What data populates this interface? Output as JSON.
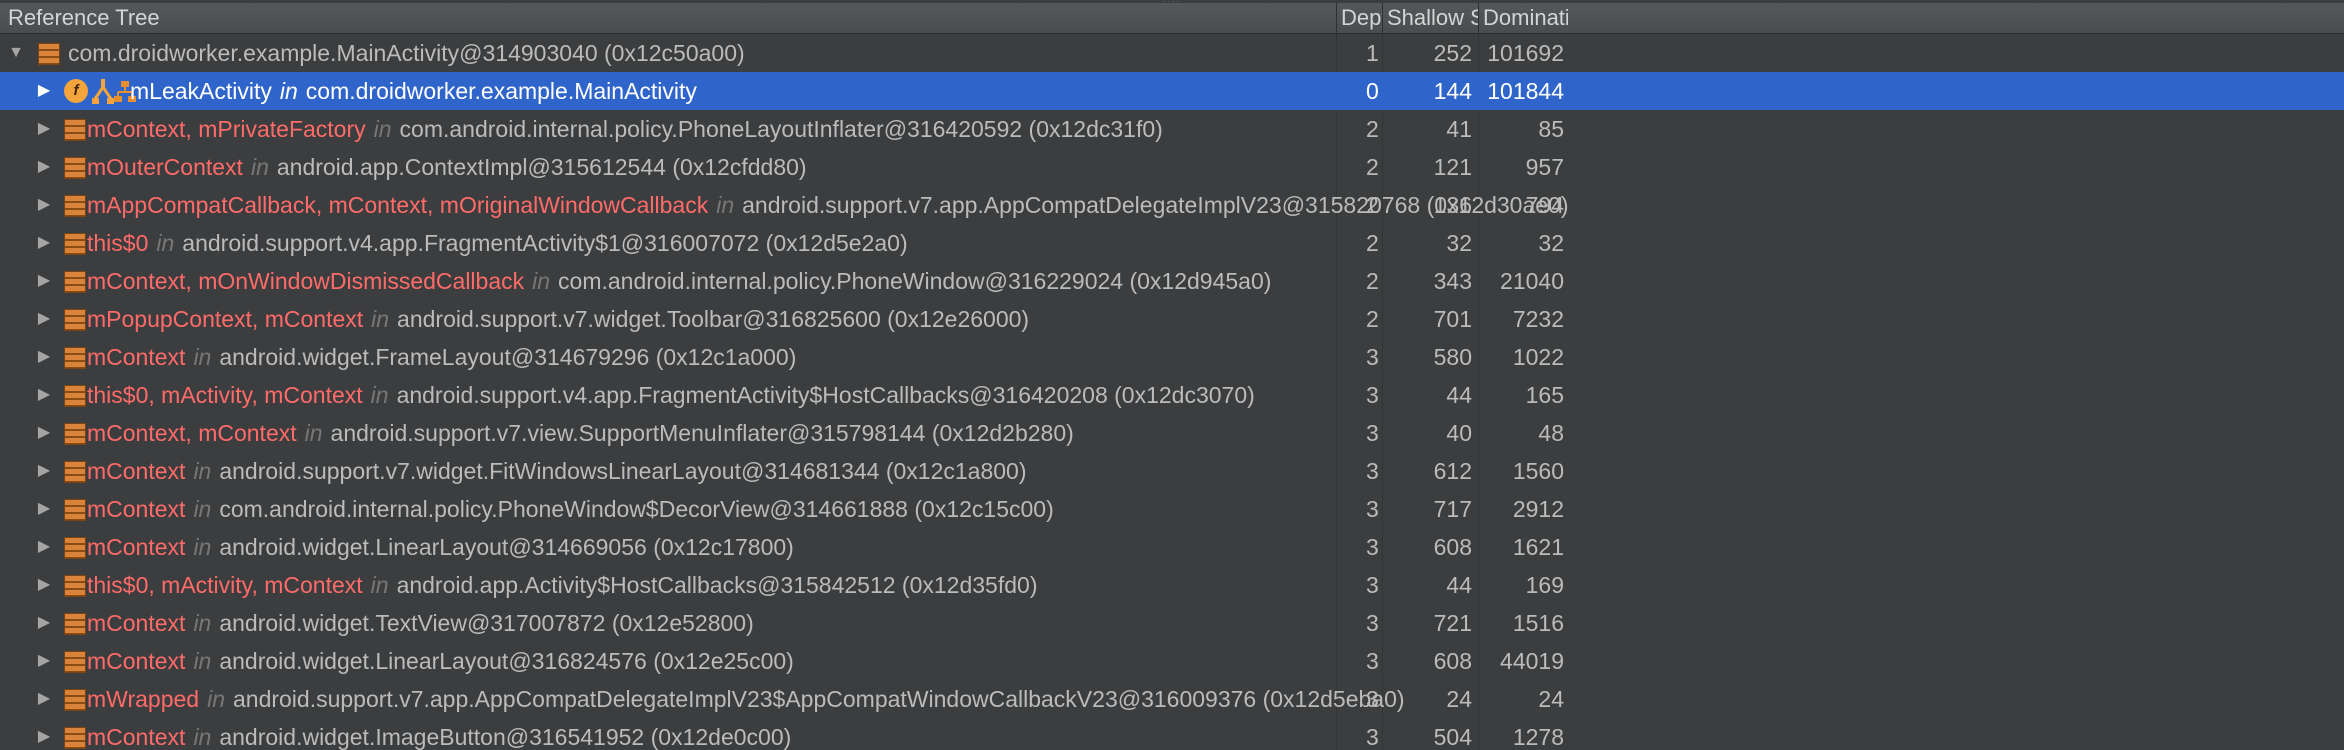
{
  "header": {
    "col_tree": "Reference Tree",
    "col_depth": "Depth",
    "col_shallow": "Shallow Size",
    "col_dominating": "Dominatin..."
  },
  "root_row": {
    "label": "com.droidworker.example.MainActivity@314903040 (0x12c50a00)",
    "depth": "1",
    "shallow": "252",
    "dominating": "101692"
  },
  "selected_row": {
    "field": "mLeakActivity",
    "in": "in",
    "cls": "com.droidworker.example.MainActivity",
    "depth": "0",
    "shallow": "144",
    "dominating": "101844"
  },
  "rows": [
    {
      "refs": "mContext, mPrivateFactory",
      "in": "in",
      "cls": "com.android.internal.policy.PhoneLayoutInflater@316420592 (0x12dc31f0)",
      "depth": "2",
      "shallow": "41",
      "dominating": "85"
    },
    {
      "refs": "mOuterContext",
      "in": "in",
      "cls": "android.app.ContextImpl@315612544 (0x12cfdd80)",
      "depth": "2",
      "shallow": "121",
      "dominating": "957"
    },
    {
      "refs": "mAppCompatCallback, mContext, mOriginalWindowCallback",
      "in": "in",
      "cls": "android.support.v7.app.AppCompatDelegateImplV23@315820768 (0x12d30ae0)",
      "depth": "2",
      "shallow": "136",
      "dominating": "794"
    },
    {
      "refs": "this$0",
      "in": "in",
      "cls": "android.support.v4.app.FragmentActivity$1@316007072 (0x12d5e2a0)",
      "depth": "2",
      "shallow": "32",
      "dominating": "32"
    },
    {
      "refs": "mContext, mOnWindowDismissedCallback",
      "in": "in",
      "cls": "com.android.internal.policy.PhoneWindow@316229024 (0x12d945a0)",
      "depth": "2",
      "shallow": "343",
      "dominating": "21040"
    },
    {
      "refs": "mPopupContext, mContext",
      "in": "in",
      "cls": "android.support.v7.widget.Toolbar@316825600 (0x12e26000)",
      "depth": "2",
      "shallow": "701",
      "dominating": "7232"
    },
    {
      "refs": "mContext",
      "in": "in",
      "cls": "android.widget.FrameLayout@314679296 (0x12c1a000)",
      "depth": "3",
      "shallow": "580",
      "dominating": "1022"
    },
    {
      "refs": "this$0, mActivity, mContext",
      "in": "in",
      "cls": "android.support.v4.app.FragmentActivity$HostCallbacks@316420208 (0x12dc3070)",
      "depth": "3",
      "shallow": "44",
      "dominating": "165"
    },
    {
      "refs": "mContext, mContext",
      "in": "in",
      "cls": "android.support.v7.view.SupportMenuInflater@315798144 (0x12d2b280)",
      "depth": "3",
      "shallow": "40",
      "dominating": "48"
    },
    {
      "refs": "mContext",
      "in": "in",
      "cls": "android.support.v7.widget.FitWindowsLinearLayout@314681344 (0x12c1a800)",
      "depth": "3",
      "shallow": "612",
      "dominating": "1560"
    },
    {
      "refs": "mContext",
      "in": "in",
      "cls": "com.android.internal.policy.PhoneWindow$DecorView@314661888 (0x12c15c00)",
      "depth": "3",
      "shallow": "717",
      "dominating": "2912"
    },
    {
      "refs": "mContext",
      "in": "in",
      "cls": "android.widget.LinearLayout@314669056 (0x12c17800)",
      "depth": "3",
      "shallow": "608",
      "dominating": "1621"
    },
    {
      "refs": "this$0, mActivity, mContext",
      "in": "in",
      "cls": "android.app.Activity$HostCallbacks@315842512 (0x12d35fd0)",
      "depth": "3",
      "shallow": "44",
      "dominating": "169"
    },
    {
      "refs": "mContext",
      "in": "in",
      "cls": "android.widget.TextView@317007872 (0x12e52800)",
      "depth": "3",
      "shallow": "721",
      "dominating": "1516"
    },
    {
      "refs": "mContext",
      "in": "in",
      "cls": "android.widget.LinearLayout@316824576 (0x12e25c00)",
      "depth": "3",
      "shallow": "608",
      "dominating": "44019"
    },
    {
      "refs": "mWrapped",
      "in": "in",
      "cls": "android.support.v7.app.AppCompatDelegateImplV23$AppCompatWindowCallbackV23@316009376 (0x12d5eba0)",
      "depth": "3",
      "shallow": "24",
      "dominating": "24"
    },
    {
      "refs": "mContext",
      "in": "in",
      "cls": "android.widget.ImageButton@316541952 (0x12de0c00)",
      "depth": "3",
      "shallow": "504",
      "dominating": "1278"
    }
  ]
}
